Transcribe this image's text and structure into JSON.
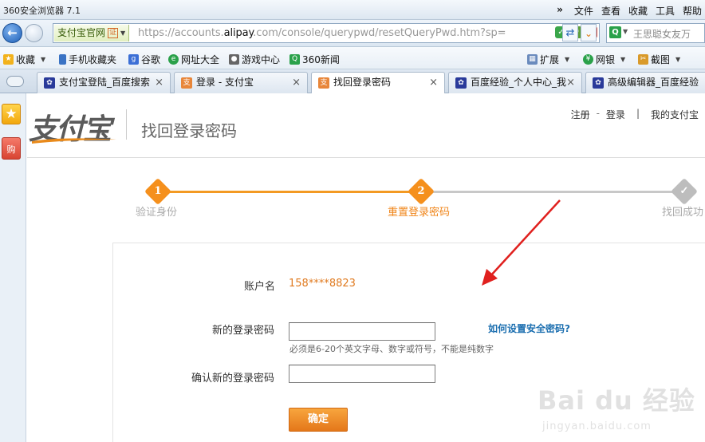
{
  "browser": {
    "app_title": "360安全浏览器 7.1",
    "menus": [
      "文件",
      "查看",
      "收藏",
      "工具",
      "帮助"
    ],
    "more_glyph": "»",
    "site_chip": "支付宝官网",
    "cert_label": "证",
    "url_prefix": "https://accounts.",
    "url_domain": "alipay",
    "url_suffix": ".com/console/querypwd/resetQueryPwd.htm?sp=",
    "search_text": "王思聪女友万",
    "avatar_text": "4"
  },
  "bookmarks": [
    {
      "label": "收藏"
    },
    {
      "label": "手机收藏夹"
    },
    {
      "label": "谷歌"
    },
    {
      "label": "网址大全"
    },
    {
      "label": "游戏中心"
    },
    {
      "label": "360新闻"
    },
    {
      "label": "扩展"
    },
    {
      "label": "网银"
    },
    {
      "label": "截图"
    }
  ],
  "tabs": [
    {
      "label": "支付宝登陆_百度搜索"
    },
    {
      "label": "登录 - 支付宝"
    },
    {
      "label": "找回登录密码"
    },
    {
      "label": "百度经验_个人中心_我"
    },
    {
      "label": "高级编辑器_百度经验"
    }
  ],
  "sidebar": {
    "shop_label": "购"
  },
  "header": {
    "logo_text": "支付宝",
    "page_title": "找回登录密码",
    "register": "注册",
    "sep": "-",
    "login": "登录",
    "pipe": "|",
    "my_alipay": "我的支付宝"
  },
  "steps": [
    {
      "num": "1",
      "label": "验证身份"
    },
    {
      "num": "2",
      "label": "重置登录密码"
    },
    {
      "num": "",
      "label": "找回成功"
    }
  ],
  "form": {
    "account_label": "账户名",
    "account_value": "158****8823",
    "new_pwd_label": "新的登录密码",
    "new_pwd_value": "",
    "hint": "必须是6-20个英文字母、数字或符号，不能是纯数字",
    "help_link": "如何设置安全密码?",
    "confirm_label": "确认新的登录密码",
    "confirm_value": "",
    "submit": "确定"
  },
  "watermark": {
    "text": "Bai du 经验",
    "url": "jingyan.baidu.com"
  },
  "colors": {
    "accent_orange": "#f5901d",
    "link_blue": "#1c6fb0",
    "annotation_red": "#e0201e"
  }
}
